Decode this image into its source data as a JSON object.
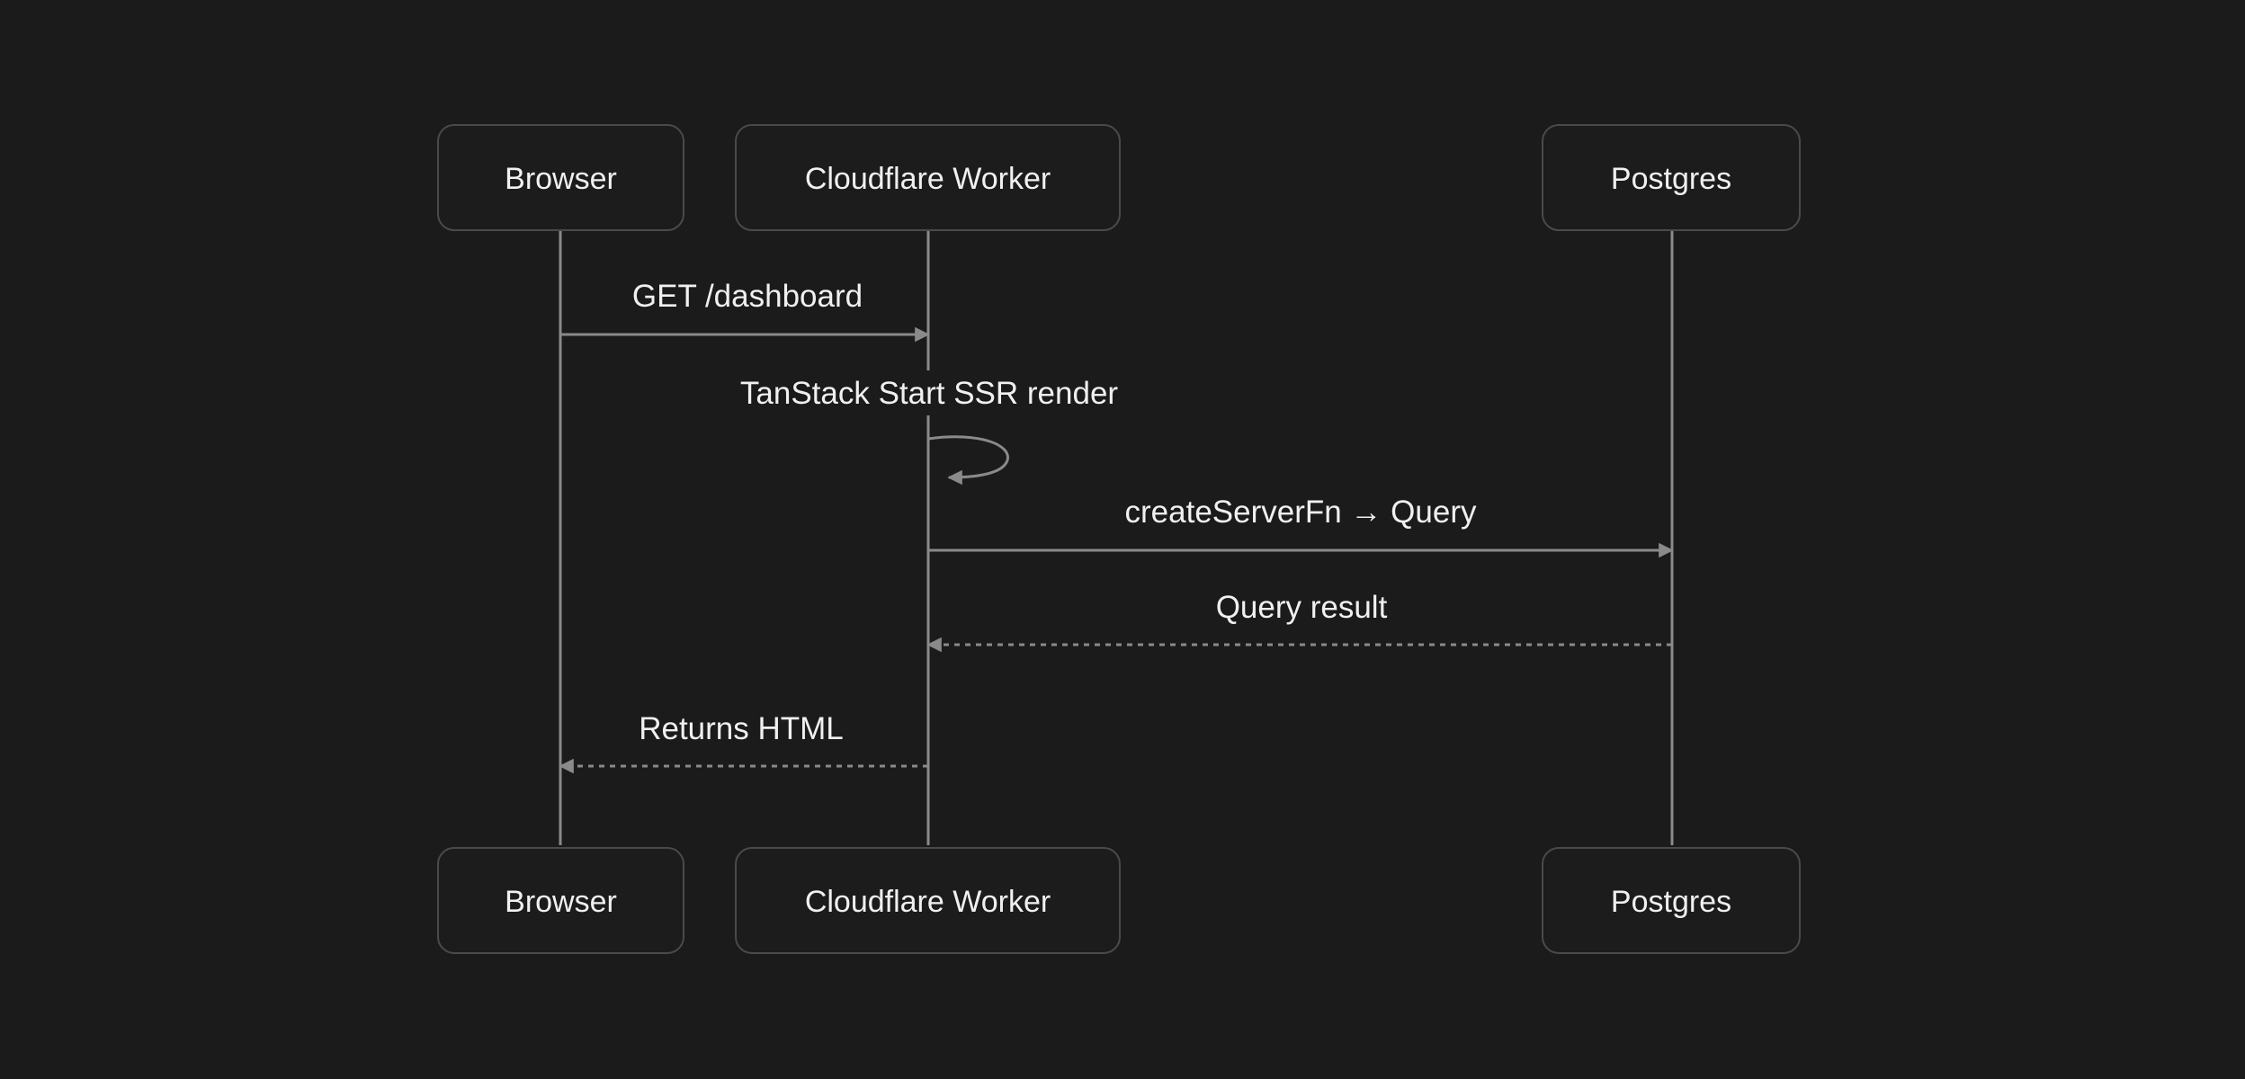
{
  "actors": [
    {
      "id": "browser",
      "label": "Browser"
    },
    {
      "id": "worker",
      "label": "Cloudflare Worker"
    },
    {
      "id": "postgres",
      "label": "Postgres"
    }
  ],
  "messages": [
    {
      "from": "browser",
      "to": "worker",
      "label": "GET /dashboard",
      "style": "solid"
    },
    {
      "from": "worker",
      "to": "worker",
      "label": "TanStack Start SSR render",
      "style": "self"
    },
    {
      "from": "worker",
      "to": "postgres",
      "label": "createServerFn → Query",
      "style": "solid"
    },
    {
      "from": "postgres",
      "to": "worker",
      "label": "Query result",
      "style": "dashed"
    },
    {
      "from": "worker",
      "to": "browser",
      "label": "Returns HTML",
      "style": "dashed"
    }
  ],
  "colors": {
    "background": "#1b1b1b",
    "line": "#8a8a8a",
    "box_border": "#4a4a4a",
    "text": "#f0f0f0"
  }
}
